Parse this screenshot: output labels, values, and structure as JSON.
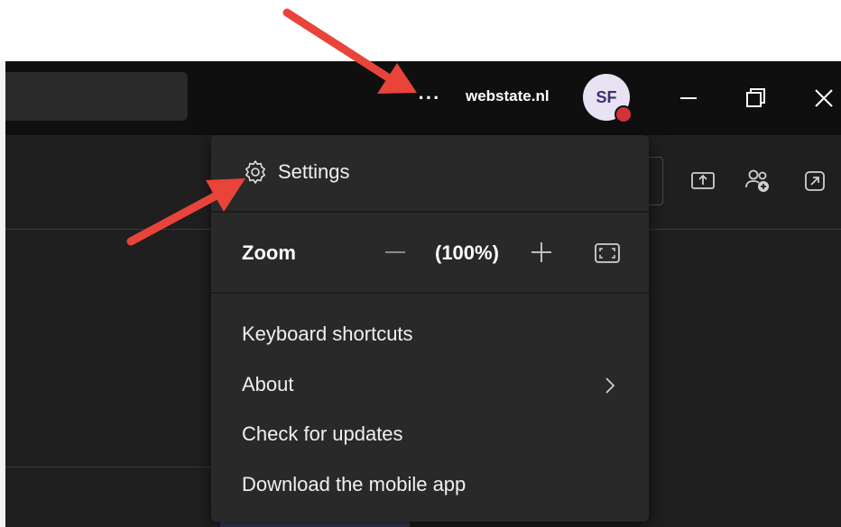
{
  "titlebar": {
    "more_label": "···",
    "org_name": "webstate.nl",
    "avatar_initials": "SF",
    "status_color": "#d13438"
  },
  "menu": {
    "settings_label": "Settings",
    "zoom_label": "Zoom",
    "zoom_value": "(100%)",
    "items": [
      {
        "label": "Keyboard shortcuts"
      },
      {
        "label": "About"
      },
      {
        "label": "Check for updates"
      },
      {
        "label": "Download the mobile app"
      }
    ]
  },
  "icons": {
    "more": "more-icon",
    "settings": "gear-icon",
    "zoom_out": "minus-icon",
    "zoom_in": "plus-icon",
    "zoom_fit": "fit-to-screen-icon",
    "about": "chevron-right-icon",
    "share": "share-screen-icon",
    "add_people": "add-people-icon",
    "pop_out": "pop-out-icon",
    "minimize": "minimize-icon",
    "restore": "restore-icon",
    "close": "close-icon"
  },
  "colors": {
    "titlebar_bg": "#0f0f0f",
    "app_bg": "#1f1f1f",
    "menu_bg": "#292929",
    "arrow": "#e8443a"
  }
}
